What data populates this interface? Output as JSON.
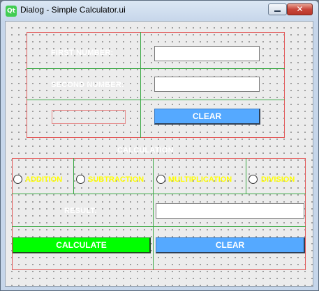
{
  "window": {
    "title": "Dialog - Simple Calculator.ui",
    "icon_label": "Qt",
    "close_glyph": "✕"
  },
  "inputs": {
    "first_number_label": "FIRST NUMBER:",
    "first_number_value": "",
    "second_number_label": "SECOND NUMBER:",
    "second_number_value": "",
    "clear_label": "CLEAR"
  },
  "calculation": {
    "title": "CALCULATION",
    "options": [
      "ADDITION",
      "SUBTRACTION",
      "MULTIPLICATION",
      "DIVISION"
    ],
    "result_label": "RESULT:",
    "result_value": "",
    "calculate_label": "CALCULATE",
    "clear_label": "CLEAR"
  },
  "colors": {
    "button_blue": "#55a9ff",
    "button_green": "#00ff00",
    "option_text": "#ffff00",
    "label_text": "#ffffff",
    "layout_border": "#e25a5a",
    "grid_line": "#3aa844"
  }
}
